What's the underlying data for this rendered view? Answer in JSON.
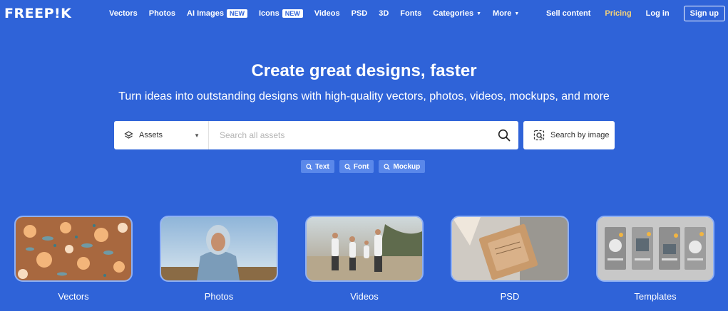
{
  "brand": {
    "logo_text": "FREEP!K"
  },
  "nav": {
    "items": [
      {
        "label": "Vectors"
      },
      {
        "label": "Photos"
      },
      {
        "label": "AI Images",
        "badge": "NEW"
      },
      {
        "label": "Icons",
        "badge": "NEW"
      },
      {
        "label": "Videos"
      },
      {
        "label": "PSD"
      },
      {
        "label": "3D"
      },
      {
        "label": "Fonts"
      },
      {
        "label": "Categories"
      },
      {
        "label": "More"
      }
    ],
    "right": {
      "sell": "Sell content",
      "pricing": "Pricing",
      "login": "Log in",
      "signup": "Sign up"
    }
  },
  "hero": {
    "title": "Create great designs, faster",
    "subtitle": "Turn ideas into outstanding designs with high-quality vectors, photos, videos, mockups, and more"
  },
  "search": {
    "asset_type": "Assets",
    "placeholder": "Search all assets",
    "value": "",
    "search_by_image": "Search by image"
  },
  "chips": [
    "Text",
    "Font",
    "Mockup"
  ],
  "categories": [
    {
      "label": "Vectors"
    },
    {
      "label": "Photos"
    },
    {
      "label": "Videos"
    },
    {
      "label": "PSD"
    },
    {
      "label": "Templates"
    }
  ],
  "colors": {
    "background": "#2f63d8",
    "pricing": "#f4d27a",
    "chip": "#5a88ea",
    "thumb_border": "#8fb0f4"
  }
}
